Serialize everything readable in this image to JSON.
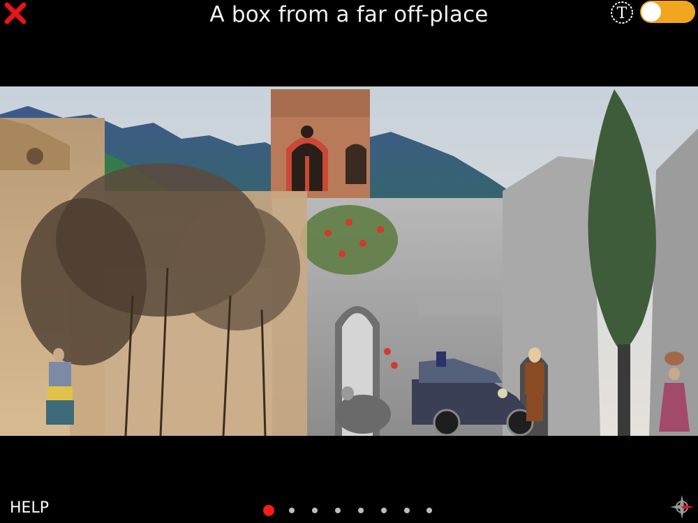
{
  "header": {
    "title": "A box from a far off-place",
    "close_icon": "close-x-icon",
    "close_color": "#e8131b",
    "text_mode_icon": "T",
    "text_toggle": {
      "state": "off",
      "color": "#f2a51e"
    }
  },
  "scene": {
    "description_icon": "collage-illustration"
  },
  "footer": {
    "help_label": "HELP",
    "pagination": {
      "total": 8,
      "current": 1,
      "active_color": "#ff1a1a"
    },
    "compass_icon": "compass-icon"
  }
}
